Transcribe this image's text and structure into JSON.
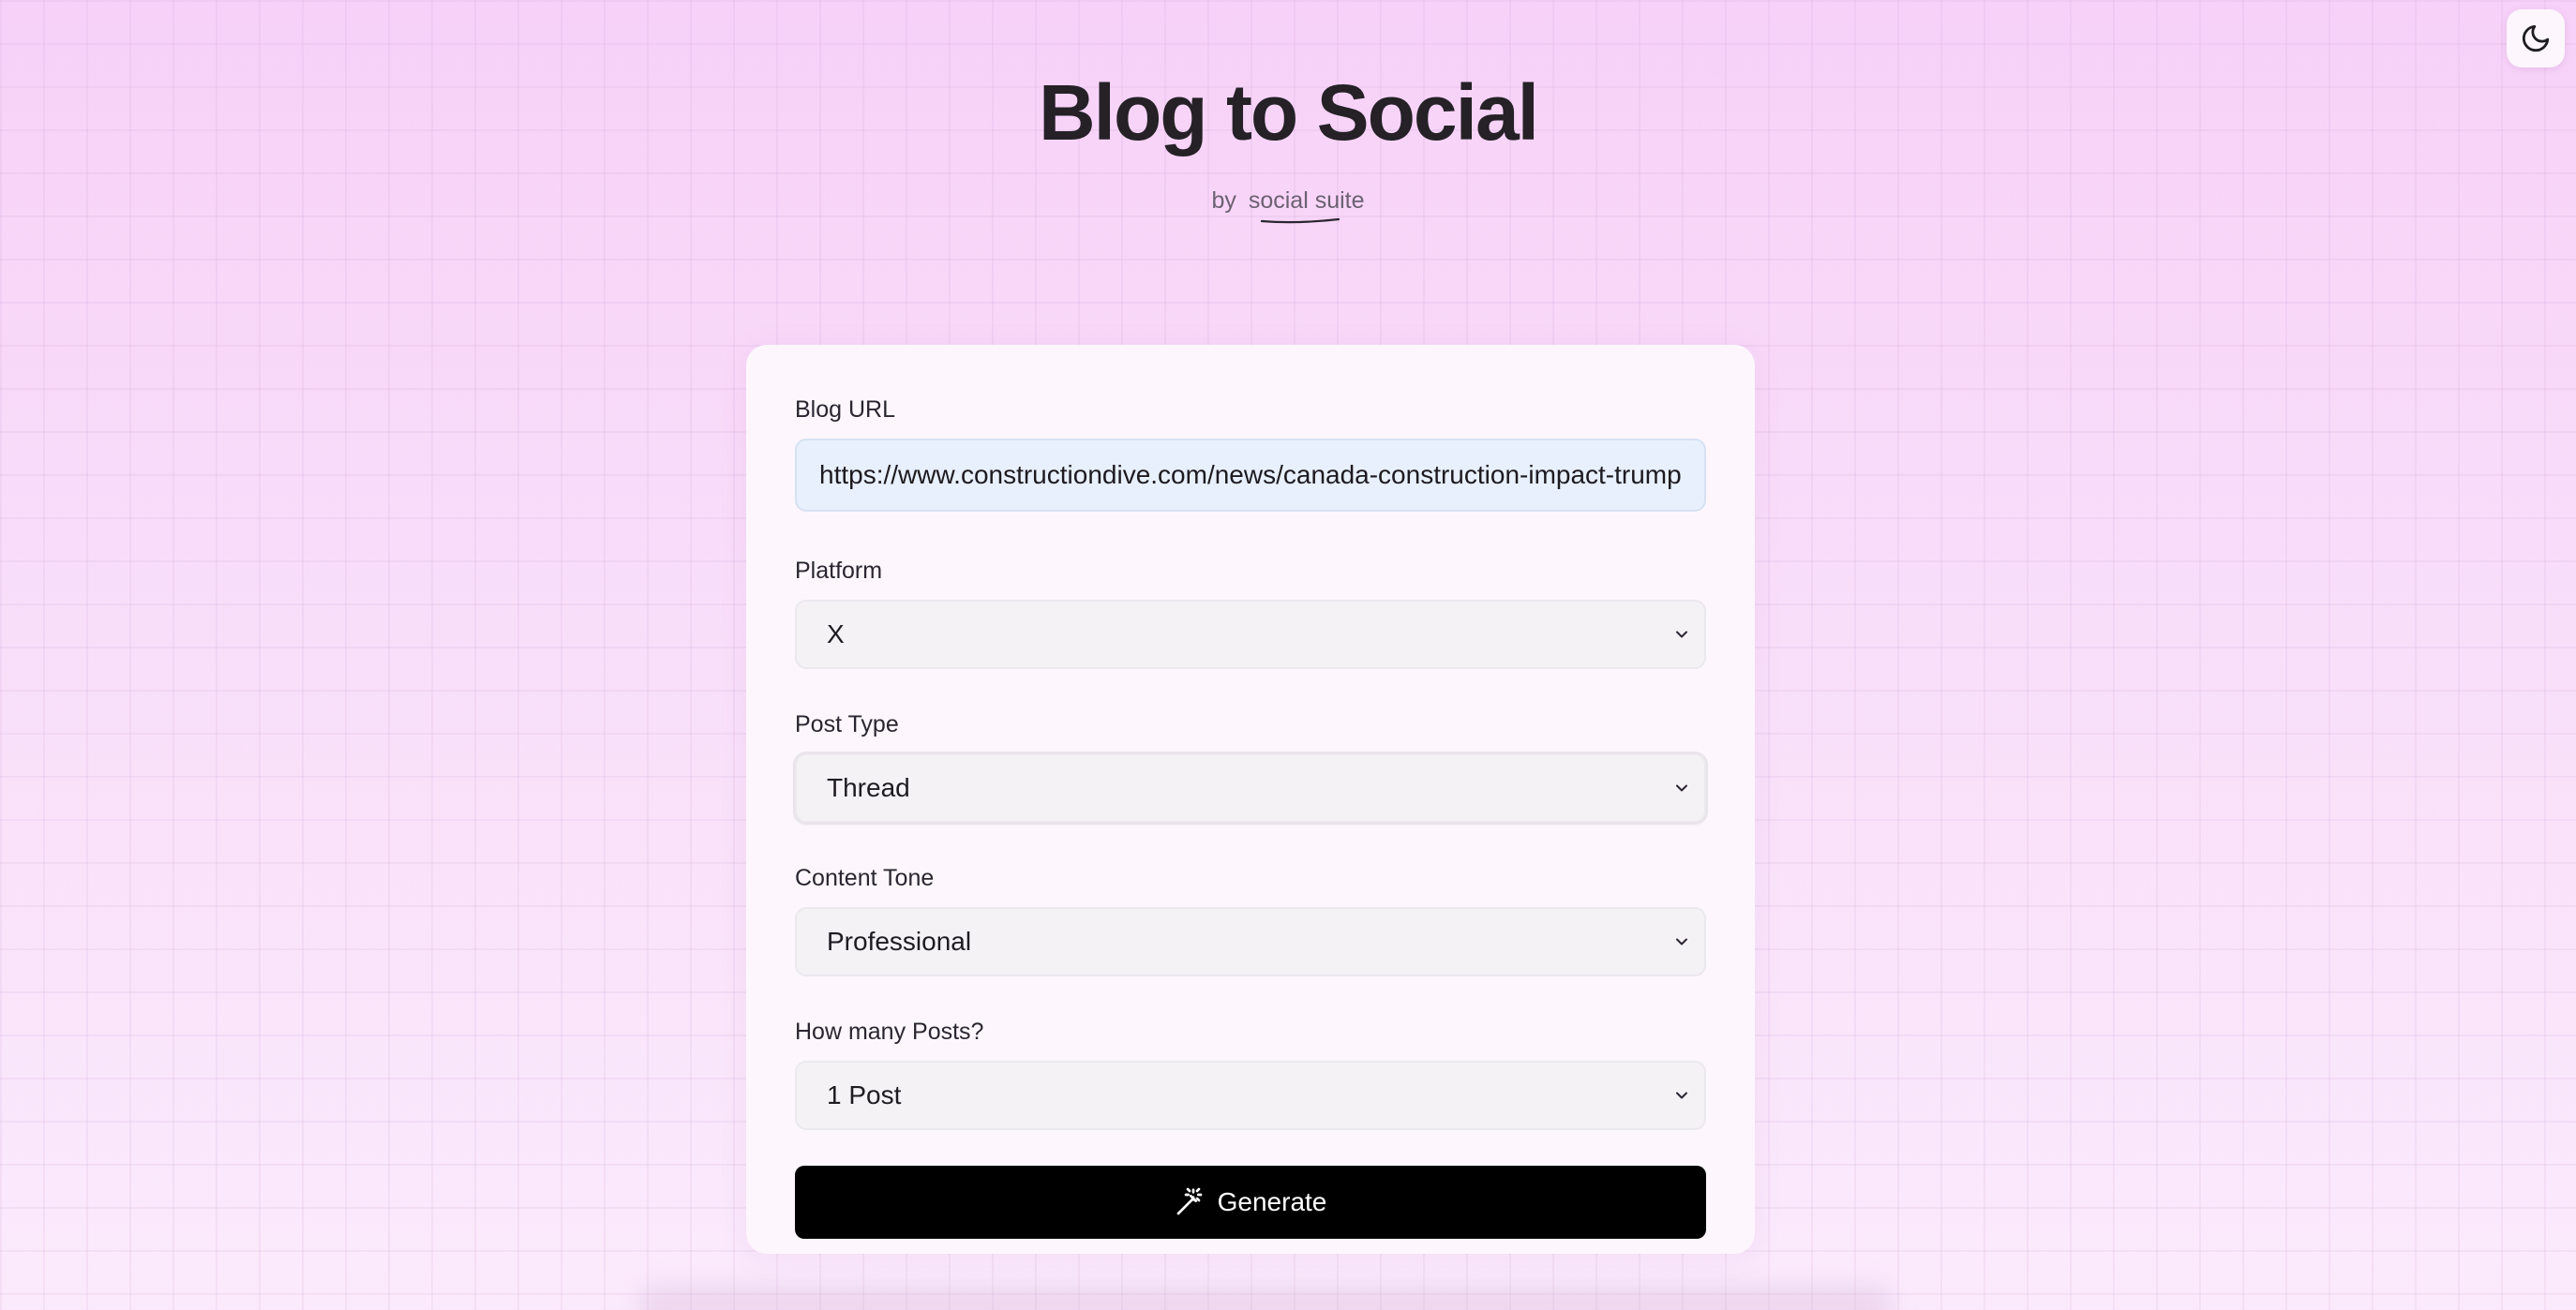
{
  "header": {
    "title": "Blog to Social",
    "byline_prefix": "by",
    "byline_link": "social suite"
  },
  "theme_toggle": {
    "icon": "moon-icon"
  },
  "form": {
    "blog_url": {
      "label": "Blog URL",
      "value": "https://www.constructiondive.com/news/canada-construction-impact-trump"
    },
    "platform": {
      "label": "Platform",
      "selected": "X"
    },
    "post_type": {
      "label": "Post Type",
      "selected": "Thread"
    },
    "content_tone": {
      "label": "Content Tone",
      "selected": "Professional"
    },
    "post_count": {
      "label": "How many Posts?",
      "selected": "1 Post"
    },
    "generate_label": "Generate"
  },
  "colors": {
    "background": "#f8d4f8",
    "card": "#fdf7fd",
    "button": "#000000",
    "url_input_bg": "#e7f0fc"
  }
}
